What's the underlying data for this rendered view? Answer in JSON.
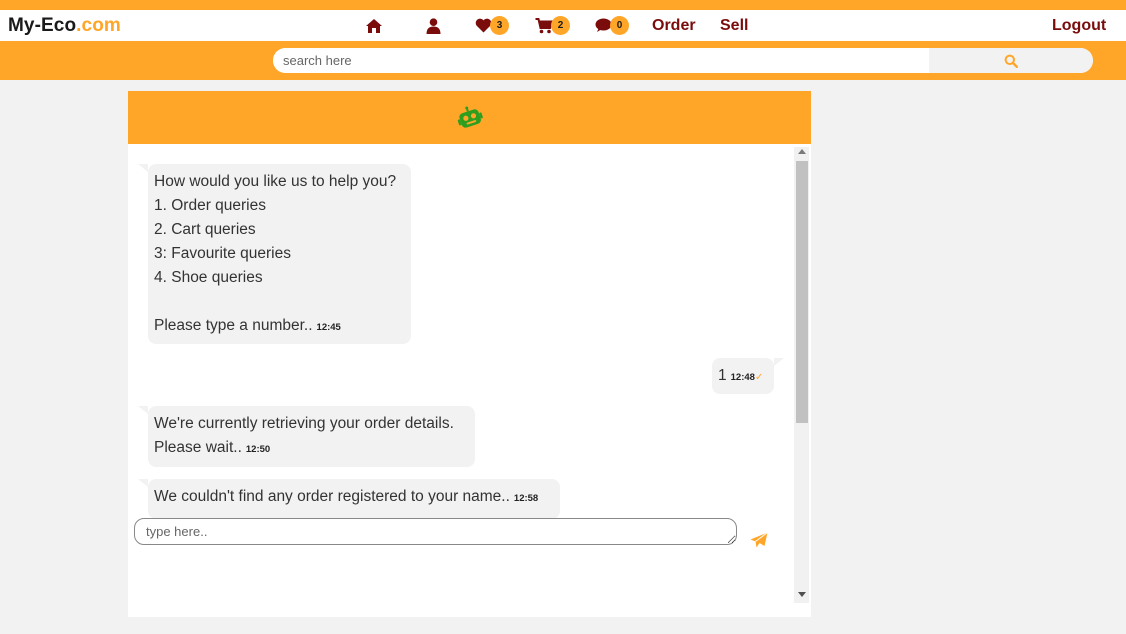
{
  "brand": {
    "name": "My-Eco",
    "suffix": ".com"
  },
  "nav": {
    "favourites_count": "3",
    "cart_count": "2",
    "messages_count": "0",
    "order_label": "Order",
    "sell_label": "Sell",
    "logout_label": "Logout"
  },
  "search": {
    "placeholder": "search here"
  },
  "chat": {
    "messages": [
      {
        "sender": "bot",
        "lines": [
          "How would you like us to help you?",
          "1. Order queries",
          "2. Cart queries",
          "3: Favourite queries",
          "4. Shoe queries",
          "",
          "Please type a number.."
        ],
        "time": "12:45"
      },
      {
        "sender": "user",
        "lines": [
          "1"
        ],
        "time": "12:48",
        "read": true
      },
      {
        "sender": "bot",
        "lines": [
          "We're currently retrieving your order details.",
          "Please wait.."
        ],
        "time": "12:50"
      },
      {
        "sender": "bot",
        "lines": [
          "We couldn't find any order registered to your name.."
        ],
        "time": "12:58"
      }
    ],
    "input_placeholder": "type here.."
  },
  "colors": {
    "accent": "#ffa629",
    "nav_text": "#7a0c0c",
    "bot_icon": "#2e9e1f"
  },
  "icons": [
    "home-icon",
    "user-icon",
    "heart-icon",
    "cart-icon",
    "comment-icon",
    "search-icon",
    "robot-icon",
    "send-icon",
    "checkmark-icon"
  ]
}
